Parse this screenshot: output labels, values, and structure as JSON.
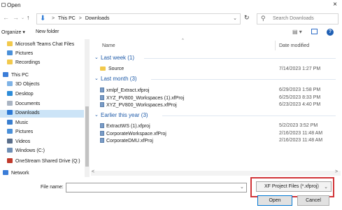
{
  "window": {
    "title": "Open",
    "close_glyph": "×"
  },
  "address": {
    "crumbs": [
      "This PC",
      "Downloads"
    ],
    "separator": ">"
  },
  "search": {
    "placeholder": "Search Downloads"
  },
  "toolbar": {
    "organize": "Organize ▾",
    "new_folder": "New folder",
    "view_glyph": "▤ ▾",
    "help": "?"
  },
  "nav": {
    "items": [
      {
        "label": "Microsoft Teams Chat Files",
        "icon": "folder-icon",
        "color": "#f2c94c"
      },
      {
        "label": "Pictures",
        "icon": "pictures-icon",
        "color": "#4a90d9"
      },
      {
        "label": "Recordings",
        "icon": "folder-icon",
        "color": "#f2c94c"
      },
      {
        "label": "This PC",
        "icon": "computer-icon",
        "color": "#3b7dd8"
      },
      {
        "label": "3D Objects",
        "icon": "cube-icon",
        "color": "#7fb3e6"
      },
      {
        "label": "Desktop",
        "icon": "desktop-icon",
        "color": "#2d8cd8"
      },
      {
        "label": "Documents",
        "icon": "documents-icon",
        "color": "#a9b4c2"
      },
      {
        "label": "Downloads",
        "icon": "download-icon",
        "color": "#2d7ad6"
      },
      {
        "label": "Music",
        "icon": "music-icon",
        "color": "#3a7fd0"
      },
      {
        "label": "Pictures",
        "icon": "pictures-icon",
        "color": "#4a90d9"
      },
      {
        "label": "Videos",
        "icon": "videos-icon",
        "color": "#5a6e8a"
      },
      {
        "label": "Windows (C:)",
        "icon": "drive-icon",
        "color": "#6f8fb5"
      },
      {
        "label": "OneStream Shared Drive (Q:)",
        "icon": "network-drive-icon",
        "color": "#c0392b"
      },
      {
        "label": "Network",
        "icon": "network-icon",
        "color": "#3b7dd8"
      }
    ],
    "selected_index": 7
  },
  "columns": {
    "name": "Name",
    "date_modified": "Date modified"
  },
  "groups": [
    {
      "label": "Last week (1)",
      "items": [
        {
          "name": "Source",
          "date": "7/14/2023 1:27 PM",
          "type": "folder"
        }
      ]
    },
    {
      "label": "Last month (3)",
      "items": [
        {
          "name": "xmlpf_Extract.xfproj",
          "date": "6/29/2023 1:58 PM",
          "type": "file"
        },
        {
          "name": "XYZ_PV800_Workspaces (1).xfProj",
          "date": "6/25/2023 8:33 PM",
          "type": "file"
        },
        {
          "name": "XYZ_PV800_Workspaces.xfProj",
          "date": "6/23/2023 4:40 PM",
          "type": "file"
        }
      ]
    },
    {
      "label": "Earlier this year (3)",
      "items": [
        {
          "name": "ExtractWS (1).xfproj",
          "date": "5/2/2023 3:52 PM",
          "type": "file"
        },
        {
          "name": "CorporateWorkspace.xfProj",
          "date": "2/16/2023 11:48 AM",
          "type": "file"
        },
        {
          "name": "CorporateDMU.xfProj",
          "date": "2/16/2023 11:48 AM",
          "type": "file"
        }
      ]
    }
  ],
  "footer": {
    "file_name_label": "File name:",
    "file_name_value": "",
    "filter_value": "XF Project Files (*.xfproj)",
    "open_label": "Open",
    "cancel_label": "Cancel"
  },
  "colors": {
    "accent": "#0078d4",
    "group_text": "#1e5aa8",
    "highlight_border": "#d13438"
  }
}
